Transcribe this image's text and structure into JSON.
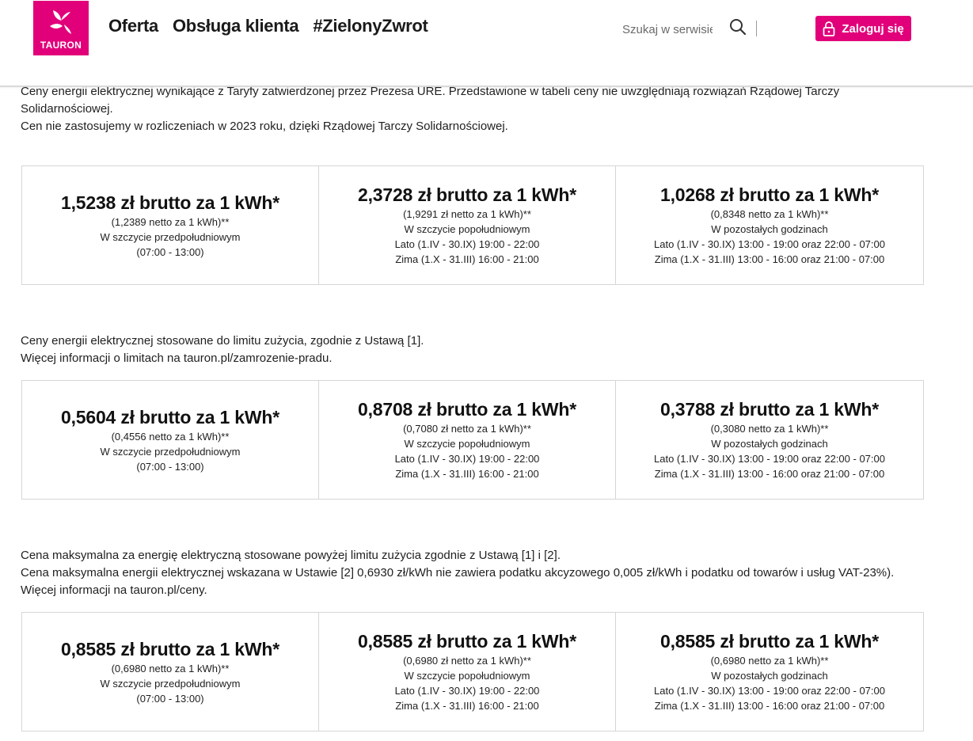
{
  "header": {
    "logo_text": "TAURON",
    "nav": [
      "Oferta",
      "Obsługa klienta",
      "#ZielonyZwrot"
    ],
    "search_placeholder": "Szukaj w serwisie",
    "login_label": "Zaloguj się",
    "brand_color": "#e2007a"
  },
  "sections": [
    {
      "text": [
        "Ceny energii elektrycznej wynikające z Taryfy zatwierdzonej przez Prezesa URE. Przedstawione w tabeli ceny nie uwzględniają rozwiązań Rządowej Tarczy Solidarnościowej.",
        "Cen nie zastosujemy w rozliczeniach w 2023 roku, dzięki Rządowej Tarczy Solidarnościowej."
      ],
      "cells": [
        {
          "price": "1,5238 zł brutto za 1 kWh*",
          "lines": [
            "(1,2389 netto za 1 kWh)**",
            "W szczycie przedpołudniowym",
            "(07:00 - 13:00)"
          ]
        },
        {
          "price": "2,3728 zł brutto za 1 kWh*",
          "lines": [
            "(1,9291 zł netto za 1 kWh)**",
            "W szczycie popołudniowym",
            "Lato (1.IV - 30.IX) 19:00 - 22:00",
            "Zima (1.X - 31.III) 16:00 - 21:00"
          ]
        },
        {
          "price": "1,0268 zł brutto za 1 kWh*",
          "lines": [
            "(0,8348 netto za 1 kWh)**",
            "W pozostałych godzinach",
            "Lato (1.IV - 30.IX) 13:00 - 19:00 oraz 22:00 - 07:00",
            "Zima (1.X - 31.III) 13:00 - 16:00 oraz 21:00 - 07:00"
          ]
        }
      ]
    },
    {
      "text": [
        "Ceny energii elektrycznej stosowane do limitu zużycia, zgodnie z Ustawą [1].",
        "Więcej informacji o limitach na tauron.pl/zamrozenie-pradu."
      ],
      "cells": [
        {
          "price": "0,5604 zł brutto za 1 kWh*",
          "lines": [
            "(0,4556 netto za 1 kWh)**",
            "W szczycie przedpołudniowym",
            "(07:00 - 13:00)"
          ]
        },
        {
          "price": "0,8708 zł brutto za 1 kWh*",
          "lines": [
            "(0,7080 zł netto za 1 kWh)**",
            "W szczycie popołudniowym",
            "Lato (1.IV - 30.IX) 19:00 - 22:00",
            "Zima (1.X - 31.III) 16:00 - 21:00"
          ]
        },
        {
          "price": "0,3788 zł brutto za 1 kWh*",
          "lines": [
            "(0,3080 netto za 1 kWh)**",
            "W pozostałych godzinach",
            "Lato (1.IV - 30.IX) 13:00 - 19:00 oraz 22:00 - 07:00",
            "Zima (1.X - 31.III) 13:00 - 16:00 oraz 21:00 - 07:00"
          ]
        }
      ]
    },
    {
      "text": [
        "Cena maksymalna za energię elektryczną stosowane powyżej limitu zużycia zgodnie z Ustawą [1] i [2].",
        "Cena maksymalna energii elektrycznej wskazana w Ustawie [2] 0,6930 zł/kWh nie zawiera podatku akcyzowego 0,005 zł/kWh i podatku od towarów i usług VAT-23%).",
        "Więcej informacji na tauron.pl/ceny."
      ],
      "cells": [
        {
          "price": "0,8585 zł brutto za 1 kWh*",
          "lines": [
            "(0,6980 netto za 1 kWh)**",
            "W szczycie przedpołudniowym",
            "(07:00 - 13:00)"
          ]
        },
        {
          "price": "0,8585 zł brutto za 1 kWh*",
          "lines": [
            "(0,6980 zł netto za 1 kWh)**",
            "W szczycie popołudniowym",
            "Lato (1.IV - 30.IX) 19:00 - 22:00",
            "Zima (1.X - 31.III) 16:00 - 21:00"
          ]
        },
        {
          "price": "0,8585 zł brutto za 1 kWh*",
          "lines": [
            "(0,6980 netto za 1 kWh)**",
            "W pozostałych godzinach",
            "Lato (1.IV - 30.IX) 13:00 - 19:00 oraz 22:00 - 07:00",
            "Zima (1.X - 31.III) 13:00 - 16:00 oraz 21:00 - 07:00"
          ]
        }
      ]
    }
  ]
}
